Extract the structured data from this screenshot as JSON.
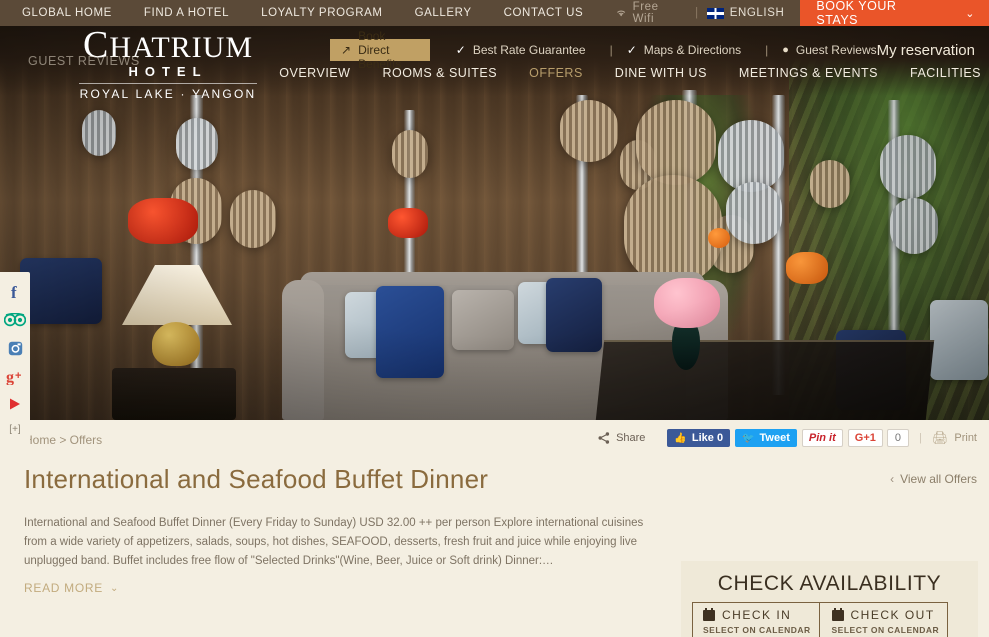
{
  "topbar": {
    "nav": [
      {
        "label": "GLOBAL HOME"
      },
      {
        "label": "FIND A HOTEL"
      },
      {
        "label": "LOYALTY PROGRAM"
      },
      {
        "label": "GALLERY"
      },
      {
        "label": "CONTACT US"
      }
    ],
    "wifi_label": "Free Wifi",
    "separator": "|",
    "language": "ENGLISH",
    "book_button": "BOOK YOUR STAYS",
    "book_chevron": "⌄",
    "bg_color": "#5b4a38",
    "accent_color": "#ea5529"
  },
  "logo": {
    "name_cap": "C",
    "name_rest": "HATRIUM",
    "sub": "HOTEL",
    "location": "ROYAL LAKE · YANGON"
  },
  "header": {
    "ghost_text": "GUEST REVIEWS",
    "book_direct": "Book Direct Benefits",
    "book_direct_arrow": "↗",
    "items": [
      {
        "label": "Best Rate Guarantee",
        "icon": "check-icon"
      },
      {
        "label": "Maps & Directions",
        "icon": "check-icon"
      },
      {
        "label": "Guest Reviews",
        "icon": "pin-icon"
      }
    ],
    "separator": "|",
    "my_reservation": "My reservation",
    "gold_color": "#c0a064"
  },
  "mainnav": {
    "items": [
      {
        "label": "OVERVIEW",
        "active": false
      },
      {
        "label": "ROOMS & SUITES",
        "active": false
      },
      {
        "label": "OFFERS",
        "active": true
      },
      {
        "label": "DINE WITH US",
        "active": false
      },
      {
        "label": "MEETINGS & EVENTS",
        "active": false
      },
      {
        "label": "FACILITIES",
        "active": false
      }
    ],
    "active_color": "#b79d6b"
  },
  "social_rail": {
    "items": [
      {
        "name": "facebook-icon",
        "glyph": "f"
      },
      {
        "name": "tripadvisor-icon",
        "glyph": "◎◎"
      },
      {
        "name": "instagram-icon",
        "glyph": "▣"
      },
      {
        "name": "googleplus-icon",
        "glyph": "g+"
      },
      {
        "name": "youtube-icon",
        "glyph": "▶"
      },
      {
        "name": "expand-icon",
        "glyph": "[+]"
      }
    ]
  },
  "content": {
    "breadcrumb": "Home > Offers",
    "share_label": "Share",
    "like_label": "Like 0",
    "tweet_label": "Tweet",
    "pin_label": "Pin it",
    "gplus_label": "G+1",
    "gplus_count": "0",
    "share_separator": "|",
    "print_label": "Print",
    "title": "International and Seafood Buffet Dinner",
    "view_all": "View all Offers",
    "view_all_arrow": "‹",
    "description": "International and Seafood Buffet Dinner (Every Friday to Sunday) USD 32.00 ++ per person Explore international cuisines from a wide variety of appetizers, salads, soups, hot dishes, SEAFOOD, desserts, fresh fruit and juice while enjoying live unplugged band. Buffet includes free flow of \"Selected Drinks\"(Wine, Beer, Juice or Soft drink) Dinner:…",
    "read_more": "READ MORE",
    "read_more_chevron": "⌄",
    "title_color": "#8a6b3e"
  },
  "availability": {
    "heading": "CHECK AVAILABILITY",
    "checkin_label": "CHECK IN",
    "checkin_sub": "SELECT ON CALENDAR",
    "checkout_label": "CHECK OUT",
    "checkout_sub": "SELECT ON CALENDAR",
    "bg_color": "#efe9d8"
  }
}
